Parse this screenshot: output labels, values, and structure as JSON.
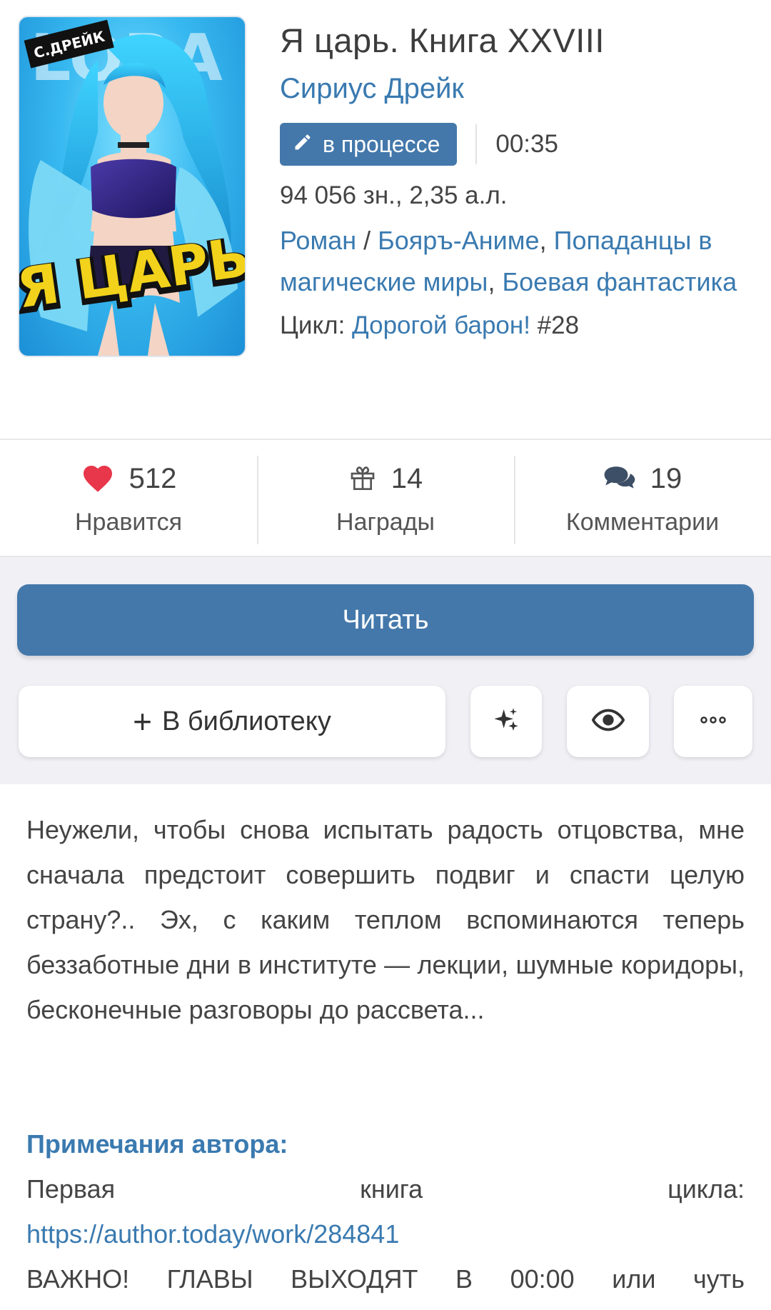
{
  "book": {
    "title": "Я царь. Книга XXVIII",
    "author": "Сириус Дрейк",
    "status": "в процессе",
    "time": "00:35",
    "size": "94 056 зн., 2,35 а.л.",
    "genres": {
      "g1": "Роман",
      "sep": " / ",
      "g2": "Бояръ-Аниме",
      "comma1": ", ",
      "g3": "Попаданцы в магические миры",
      "comma2": ", ",
      "g4": "Боевая фантастика"
    },
    "cycle_prefix": "Цикл: ",
    "cycle_link": "Дорогой барон!",
    "cycle_number": " #28",
    "cover": {
      "author_tag": "С.ДРЕЙК",
      "title_text": "Я ЦАРЬ",
      "bg_text": "LORA"
    }
  },
  "stats": {
    "likes": {
      "count": "512",
      "label": "Нравится",
      "icon": "heart-icon"
    },
    "awards": {
      "count": "14",
      "label": "Награды",
      "icon": "gift-icon"
    },
    "comments": {
      "count": "19",
      "label": "Комментарии",
      "icon": "comments-icon"
    }
  },
  "actions": {
    "read": "Читать",
    "library_plus": "+",
    "library": "В библиотеку"
  },
  "description": "Неужели, чтобы снова испытать радость отцовства, мне сначала предстоит совершить подвиг и спасти целую страну?.. Эх, с каким теплом вспоминаются теперь беззаботные дни в институте — лекции, шумные коридоры, бесконечные разговоры до рассвета...",
  "notes": {
    "title": "Примечания автора:",
    "line1": [
      "Первая",
      "книга",
      "цикла:"
    ],
    "link": "https://author.today/work/284841",
    "line3": [
      "ВАЖНО!",
      "ГЛАВЫ",
      "ВЫХОДЯТ",
      "В",
      "00:00",
      "или",
      "чуть"
    ]
  },
  "colors": {
    "accent": "#4478ab",
    "link": "#3a7ab0",
    "heart": "#e8364a",
    "panel_bg": "#f0f0f5"
  }
}
